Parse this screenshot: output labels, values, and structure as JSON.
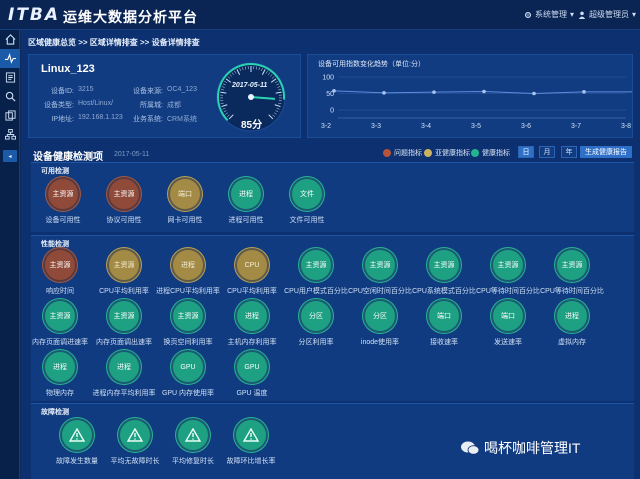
{
  "header": {
    "logo": "ITBA",
    "title": "运维大数据分析平台",
    "system_menu": "系统管理",
    "user": "超级管理员"
  },
  "breadcrumb": {
    "text": "区域健康总览 >> 区域详情排查 >> 设备详情排查"
  },
  "device": {
    "name": "Linux_123",
    "fields": [
      {
        "k": "设备ID:",
        "v": "3215"
      },
      {
        "k": "设备类型:",
        "v": "Host/Linux/"
      },
      {
        "k": "IP地址:",
        "v": "192.168.1.123"
      },
      {
        "k": "设备来源:",
        "v": "OC4_123"
      },
      {
        "k": "所属城:",
        "v": "成都"
      },
      {
        "k": "业务系统:",
        "v": "CRM系统"
      }
    ],
    "gauge_date": "2017-05-11",
    "score_text": "85分",
    "score": 85
  },
  "trend": {
    "title": "设备可用指数变化趋势（单位:分）",
    "chart_data": {
      "type": "line",
      "x": [
        "3-2",
        "3-3",
        "3-4",
        "3-5",
        "3-6",
        "3-7",
        "3-8"
      ],
      "y_ticks": [
        "100",
        "50",
        "0"
      ],
      "values": [
        58,
        52,
        54,
        56,
        50,
        55,
        55
      ],
      "ylim": [
        0,
        100
      ]
    }
  },
  "section": {
    "title": "设备健康检测项",
    "date": "2017-05-11",
    "legend": [
      {
        "label": "问题指标",
        "color": "#b5533c"
      },
      {
        "label": "亚健康指标",
        "color": "#c9b35e"
      },
      {
        "label": "健康指标",
        "color": "#22b58f"
      }
    ],
    "periods": [
      "日",
      "月",
      "年"
    ],
    "report_button": "生成健康报告"
  },
  "groups": [
    {
      "title": "可用检测",
      "items": [
        {
          "icon": "主资源",
          "label": "设备可用性",
          "status": "red"
        },
        {
          "icon": "主资源",
          "label": "协议可用性",
          "status": "red"
        },
        {
          "icon": "端口",
          "label": "网卡可用性",
          "status": "yellow"
        },
        {
          "icon": "进程",
          "label": "进程可用性",
          "status": "green"
        },
        {
          "icon": "文件",
          "label": "文件可用性",
          "status": "green"
        }
      ]
    },
    {
      "title": "性能检测",
      "items": [
        {
          "icon": "主资源",
          "label": "响应时间",
          "status": "red"
        },
        {
          "icon": "主资源",
          "label": "CPU平均利用率",
          "status": "yellow"
        },
        {
          "icon": "进程",
          "label": "进程CPU平均利用率",
          "status": "yellow"
        },
        {
          "icon": "CPU",
          "label": "CPU平均利用率",
          "status": "yellow"
        },
        {
          "icon": "主资源",
          "label": "CPU用户模式百分比",
          "status": "green"
        },
        {
          "icon": "主资源",
          "label": "CPU空闲时间百分比",
          "status": "green"
        },
        {
          "icon": "主资源",
          "label": "CPU系统模式百分比",
          "status": "green"
        },
        {
          "icon": "主资源",
          "label": "CPU等待时间百分比",
          "status": "green"
        },
        {
          "icon": "主资源",
          "label": "CPU等待时间百分比",
          "status": "green"
        },
        {
          "icon": "主资源",
          "label": "内存页面调进速率",
          "status": "green"
        },
        {
          "icon": "主资源",
          "label": "内存页面调出速率",
          "status": "green"
        },
        {
          "icon": "主资源",
          "label": "换页空间利用率",
          "status": "green"
        },
        {
          "icon": "进程",
          "label": "主机内存利用率",
          "status": "green"
        },
        {
          "icon": "分区",
          "label": "分区利用率",
          "status": "green"
        },
        {
          "icon": "分区",
          "label": "inode使用率",
          "status": "green"
        },
        {
          "icon": "端口",
          "label": "接收速率",
          "status": "green"
        },
        {
          "icon": "端口",
          "label": "发送速率",
          "status": "green"
        },
        {
          "icon": "进程",
          "label": "虚拟内存",
          "status": "green"
        },
        {
          "icon": "进程",
          "label": "物理内存",
          "status": "green"
        },
        {
          "icon": "进程",
          "label": "进程内存平均利用率",
          "status": "green"
        },
        {
          "icon": "GPU",
          "label": "GPU 内存使用率",
          "status": "green"
        },
        {
          "icon": "GPU",
          "label": "GPU 温度",
          "status": "green"
        }
      ]
    },
    {
      "title": "故障检测",
      "items": [
        {
          "icon": "warning",
          "label": "故障发生数量",
          "status": "green"
        },
        {
          "icon": "warning",
          "label": "平均无故障时长",
          "status": "green"
        },
        {
          "icon": "warning",
          "label": "平均修复时长",
          "status": "green"
        },
        {
          "icon": "warning",
          "label": "故障环比增长率",
          "status": "green"
        }
      ]
    }
  ],
  "watermark": "喝杯咖啡管理IT",
  "sidebar": [
    "home-icon",
    "monitor-icon",
    "list-icon",
    "search-icon",
    "copy-icon",
    "hierarchy-icon",
    "collapse-icon"
  ]
}
